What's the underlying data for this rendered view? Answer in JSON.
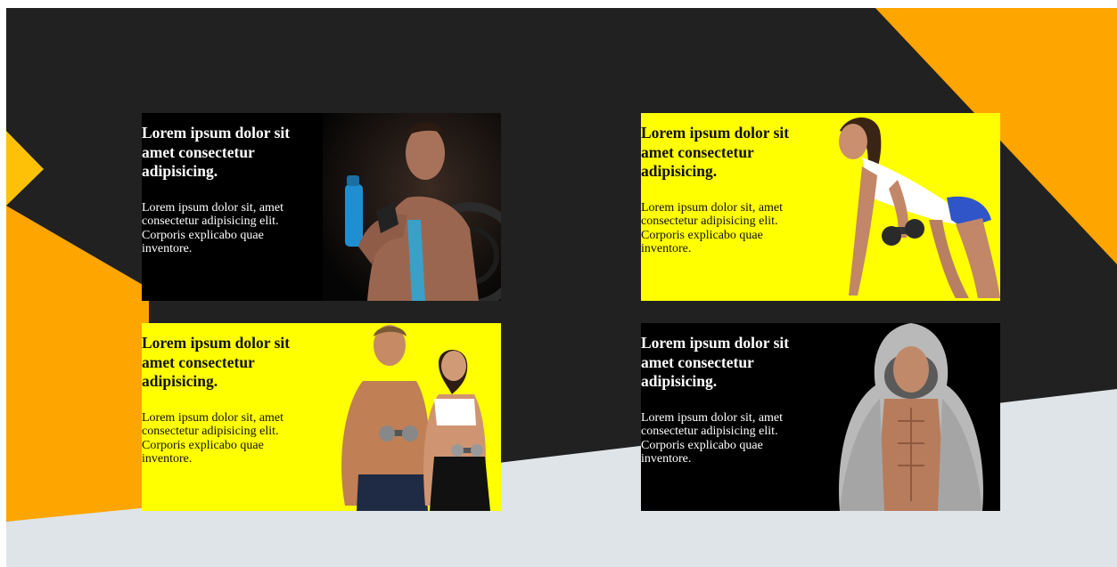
{
  "colors": {
    "background_dark": "#212121",
    "accent_orange": "#ffa500",
    "accent_yellow": "#ffff00",
    "page_light": "#dfe4e8",
    "card_dark": "#000000"
  },
  "cards": [
    {
      "heading": "Lorem ipsum dolor sit amet consectetur adipisicing.",
      "body": "Lorem ipsum dolor sit, amet consectetur adipisicing elit. Corporis explicabo quae inventore.",
      "theme": "dark",
      "image": "man-drinking-shaker-photo"
    },
    {
      "heading": "Lorem ipsum dolor sit amet consectetur adipisicing.",
      "body": "Lorem ipsum dolor sit, amet consectetur adipisicing elit. Corporis explicabo quae inventore.",
      "theme": "yellow",
      "image": "woman-dumbbell-row-photo"
    },
    {
      "heading": "Lorem ipsum dolor sit amet consectetur adipisicing.",
      "body": "Lorem ipsum dolor sit, amet consectetur adipisicing elit. Corporis explicabo quae inventore.",
      "theme": "yellow",
      "image": "fitness-couple-photo"
    },
    {
      "heading": "Lorem ipsum dolor sit amet consectetur adipisicing.",
      "body": "Lorem ipsum dolor sit, amet consectetur adipisicing elit. Corporis explicabo quae inventore.",
      "theme": "dark",
      "image": "man-hoodie-photo"
    }
  ]
}
